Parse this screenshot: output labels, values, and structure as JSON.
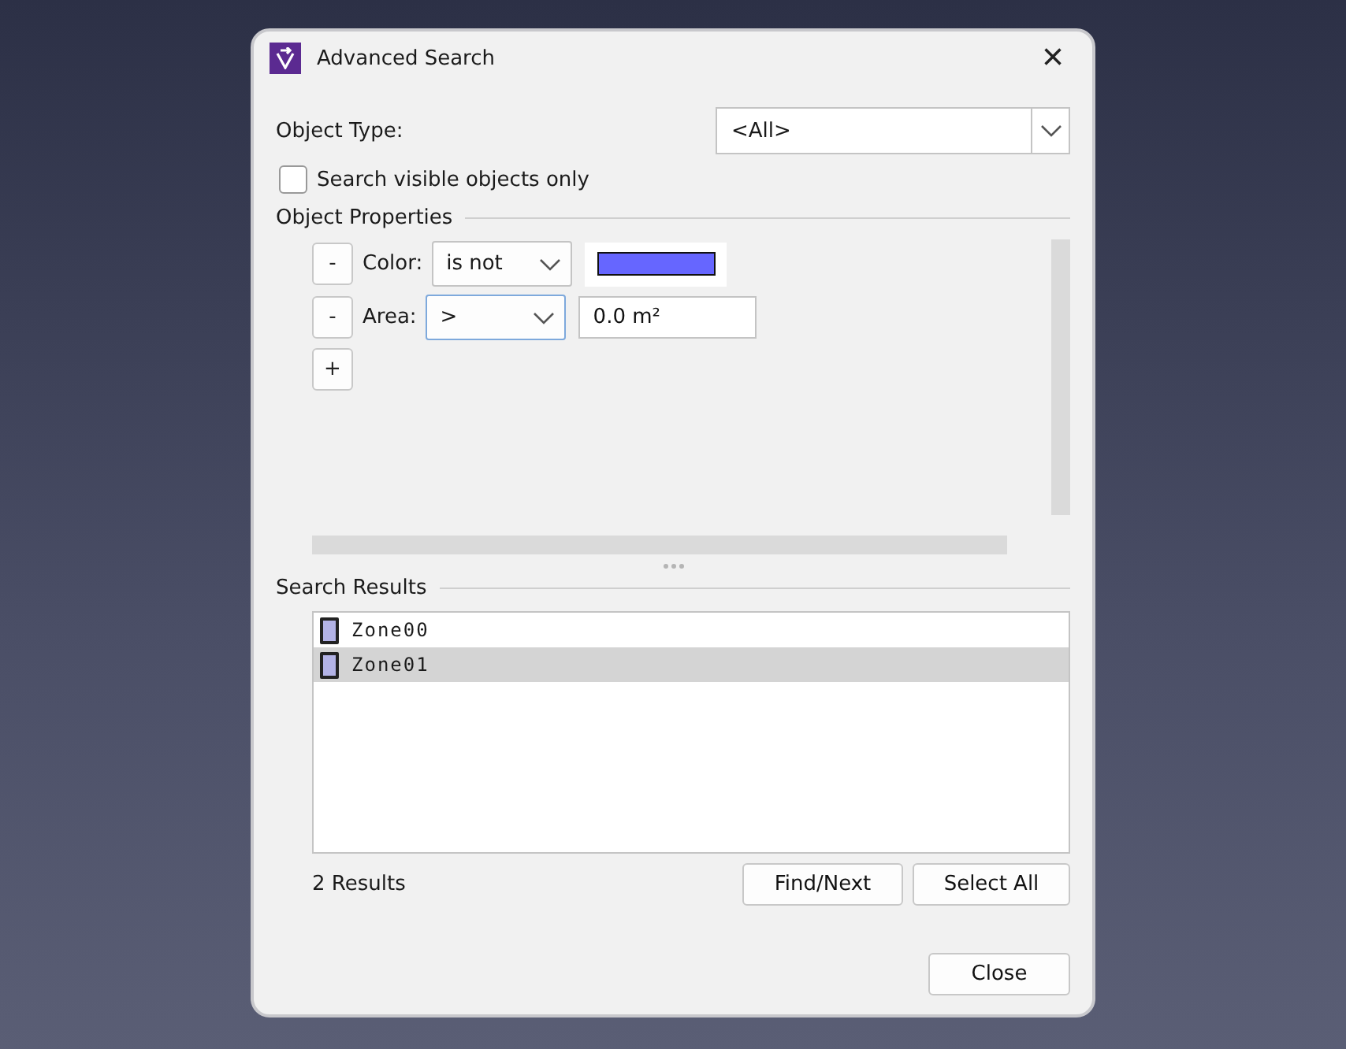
{
  "window": {
    "title": "Advanced Search",
    "close": "×"
  },
  "object_type": {
    "label": "Object Type:",
    "value": "<All>"
  },
  "visible_only": {
    "label": "Search visible objects only",
    "checked": false
  },
  "properties": {
    "title": "Object Properties",
    "add_button": "+",
    "conditions": [
      {
        "kind": "color",
        "remove": "-",
        "label": "Color:",
        "operator": "is not",
        "focused": false,
        "color": "#6666ff"
      },
      {
        "kind": "text",
        "remove": "-",
        "label": "Area:",
        "operator": ">",
        "focused": true,
        "value": "0.0 m²"
      }
    ]
  },
  "results": {
    "title": "Search Results",
    "items": [
      {
        "name": "Zone00",
        "selected": false,
        "color": "#b3b3e6"
      },
      {
        "name": "Zone01",
        "selected": true,
        "color": "#b3b3e6"
      }
    ],
    "count": "2 Results",
    "buttons": [
      "Find/Next",
      "Select All"
    ]
  },
  "close_button": "Close"
}
